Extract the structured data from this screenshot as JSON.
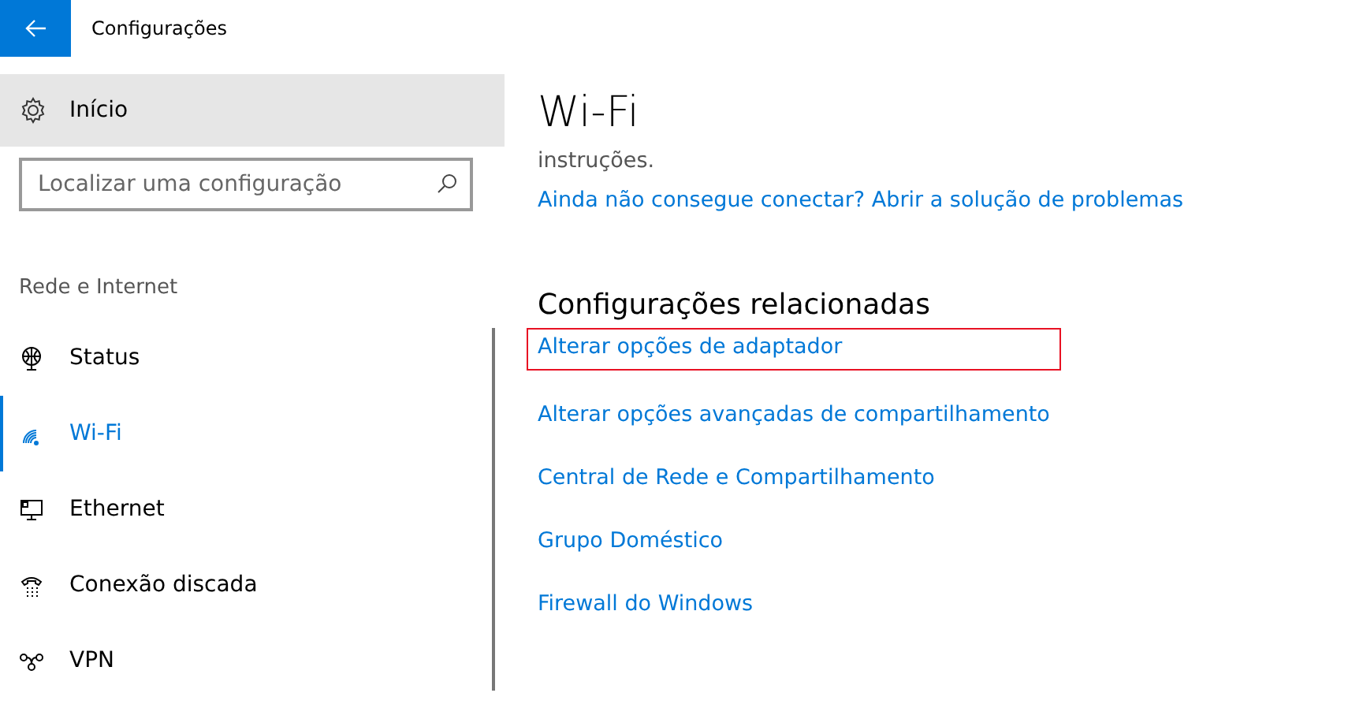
{
  "window": {
    "title": "Configurações"
  },
  "sidebar": {
    "home": "Início",
    "search": {
      "placeholder": "Localizar uma configuração"
    },
    "section": "Rede e Internet",
    "items": [
      {
        "label": "Status",
        "selected": false
      },
      {
        "label": "Wi-Fi",
        "selected": true
      },
      {
        "label": "Ethernet",
        "selected": false
      },
      {
        "label": "Conexão discada",
        "selected": false
      },
      {
        "label": "VPN",
        "selected": false
      }
    ]
  },
  "content": {
    "title": "Wi-Fi",
    "text": "instruções.",
    "troubleshoot_link": "Ainda não consegue conectar? Abrir a solução de problemas",
    "related_heading": "Configurações relacionadas",
    "related_links": [
      {
        "label": "Alterar opções de adaptador",
        "highlighted": true
      },
      {
        "label": "Alterar opções avançadas de compartilhamento",
        "highlighted": false
      },
      {
        "label": "Central de Rede e Compartilhamento",
        "highlighted": false
      },
      {
        "label": "Grupo Doméstico",
        "highlighted": false
      },
      {
        "label": "Firewall do Windows",
        "highlighted": false
      }
    ]
  }
}
